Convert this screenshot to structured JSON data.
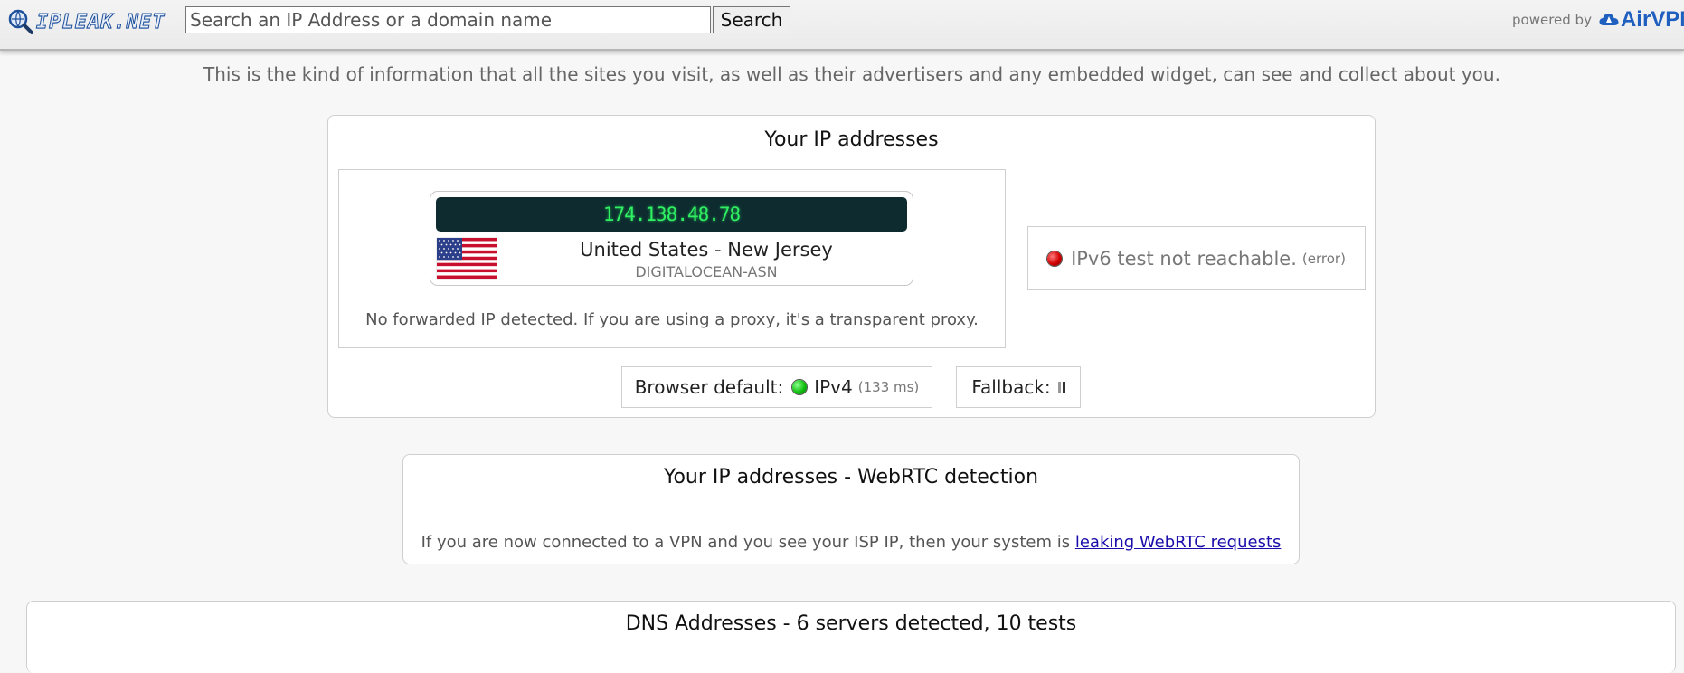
{
  "header": {
    "logo_text": "IPLEAK.NET",
    "search_placeholder": "Search an IP Address or a domain name",
    "search_button": "Search",
    "powered_by_label": "powered by",
    "powered_by_brand": "AirVPN"
  },
  "intro": "This is the kind of information that all the sites you visit, as well as their advertisers and any embedded widget, can see and collect about you.",
  "ip_section": {
    "title": "Your IP addresses",
    "ipv4": {
      "address": "174.138.48.78",
      "location": "United States - New Jersey",
      "asn": "DIGITALOCEAN-ASN",
      "forwarded_note": "No forwarded IP detected. If you are using a proxy, it's a transparent proxy."
    },
    "ipv6": {
      "message": "IPv6 test not reachable.",
      "detail": "(error)"
    },
    "browser_default": {
      "label": "Browser default:",
      "protocol": "IPv4",
      "latency": "(133 ms)"
    },
    "fallback_label": "Fallback:"
  },
  "webrtc_section": {
    "title": "Your IP addresses - WebRTC detection",
    "note": "If you are now connected to a VPN and you see your ISP IP, then your system is",
    "link": "leaking WebRTC requests"
  },
  "dns_section": {
    "title": "DNS Addresses - 6 servers detected, 10 tests"
  },
  "colors": {
    "ip_display_bg": "#0e2b30",
    "ip_display_text": "#2ff063",
    "status_ok": "#0fbf0f",
    "status_error": "#d10000",
    "brand": "#1f5fbf",
    "link": "#1a0dab"
  },
  "icons": [
    "magnifier-globe-logo-icon",
    "us-flag-icon",
    "status-led-red-icon",
    "status-led-green-icon",
    "loading-spinner-icon",
    "airvpn-cloud-icon"
  ]
}
